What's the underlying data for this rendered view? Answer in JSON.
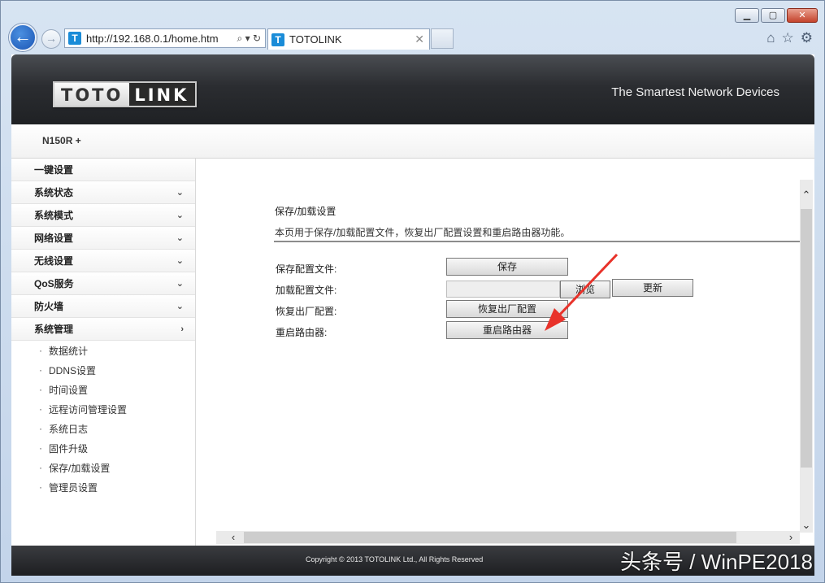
{
  "window": {
    "minimize": "▁",
    "maximize": "▢",
    "close": "✕"
  },
  "browser": {
    "address": "http://192.168.0.1/home.htm",
    "address_controls": "⌕ ▾ ↻",
    "favicon_letter": "T",
    "tab_title": "TOTOLINK",
    "tab_close": "✕",
    "tools": [
      "home-icon",
      "star-icon",
      "gear-icon"
    ]
  },
  "header": {
    "logo_part1": "TOTO",
    "logo_part2": "LINK",
    "slogan": "The Smartest Network Devices"
  },
  "model": "N150R +",
  "sidebar": {
    "items": [
      {
        "label": "一键设置",
        "chevron": ""
      },
      {
        "label": "系统状态",
        "chevron": "⌄"
      },
      {
        "label": "系统模式",
        "chevron": "⌄"
      },
      {
        "label": "网络设置",
        "chevron": "⌄"
      },
      {
        "label": "无线设置",
        "chevron": "⌄"
      },
      {
        "label": "QoS服务",
        "chevron": "⌄"
      },
      {
        "label": "防火墙",
        "chevron": "⌄"
      },
      {
        "label": "系统管理",
        "chevron": "›"
      }
    ],
    "subitems": [
      "数据统计",
      "DDNS设置",
      "时间设置",
      "远程访问管理设置",
      "系统日志",
      "固件升级",
      "保存/加载设置",
      "管理员设置"
    ]
  },
  "content": {
    "title": "保存/加载设置",
    "description": "本页用于保存/加载配置文件，恢复出厂配置设置和重启路由器功能。",
    "rows": {
      "save_label": "保存配置文件:",
      "save_button": "保存",
      "load_label": "加载配置文件:",
      "browse_button": "浏览",
      "update_button": "更新",
      "restore_label": "恢复出厂配置:",
      "restore_button": "恢复出厂配置",
      "reboot_label": "重启路由器:",
      "reboot_button": "重启路由器"
    }
  },
  "footer": {
    "copyright": "Copyright © 2013 TOTOLINK Ltd.,   All Rights Reserved",
    "watermark": "头条号 / WinPE2018"
  },
  "colors": {
    "annotation_arrow": "#e8322a",
    "header_bg": "#2b2d31"
  }
}
